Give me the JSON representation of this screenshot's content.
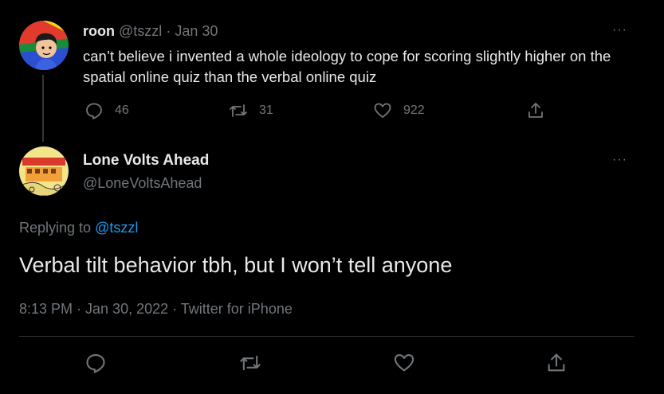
{
  "parent_tweet": {
    "name": "roon",
    "handle": "@tszzl",
    "date": "Jan 30",
    "text": "can’t believe i invented a whole ideology to cope for scoring slightly higher on the spatial online quiz than the verbal online quiz",
    "more_label": "···",
    "reply_count": "46",
    "retweet_count": "31",
    "like_count": "922"
  },
  "reply_tweet": {
    "name": "Lone Volts Ahead",
    "handle": "@LoneVoltsAhead",
    "more_label": "···",
    "replying_prefix": "Replying to",
    "replying_mention": "@tszzl",
    "text": "Verbal tilt behavior tbh, but I won’t tell anyone",
    "timestamp": "8:13 PM · Jan 30, 2022 · Twitter for iPhone"
  },
  "icons": {
    "reply": "reply-icon",
    "retweet": "retweet-icon",
    "like": "heart-icon",
    "share": "share-icon",
    "more": "more-icon"
  },
  "colors": {
    "background": "#000000",
    "text": "#e7e9ea",
    "muted": "#71767b",
    "link": "#1d9bf0",
    "divider": "#2f3336"
  }
}
